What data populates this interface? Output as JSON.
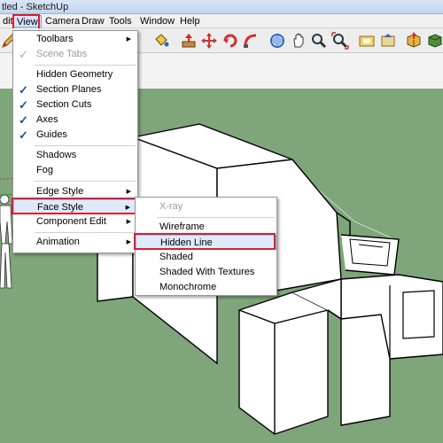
{
  "window": {
    "title": "tled - SketchUp"
  },
  "menubar": {
    "items": [
      {
        "label": "dit"
      },
      {
        "label": "View"
      },
      {
        "label": "Camera"
      },
      {
        "label": "Draw"
      },
      {
        "label": "Tools"
      },
      {
        "label": "Window"
      },
      {
        "label": "Help"
      }
    ]
  },
  "toolbar": {
    "icons": [
      "pencil-icon",
      "paint-bucket-icon",
      "push-pull-icon",
      "move-icon",
      "rotate-icon",
      "follow-me-icon",
      "orbit-icon",
      "pan-icon",
      "zoom-icon",
      "zoom-extents-icon",
      "get-models-icon",
      "share-model-icon",
      "components-icon",
      "styles-icon"
    ]
  },
  "view_menu": {
    "items": [
      {
        "label": "Toolbars",
        "submenu": true
      },
      {
        "label": "Scene Tabs",
        "checked": true,
        "disabled": true
      },
      {
        "label": "Hidden Geometry"
      },
      {
        "label": "Section Planes",
        "checked": true
      },
      {
        "label": "Section Cuts",
        "checked": true
      },
      {
        "label": "Axes",
        "checked": true
      },
      {
        "label": "Guides",
        "checked": true
      },
      {
        "label": "Shadows"
      },
      {
        "label": "Fog"
      },
      {
        "label": "Edge Style",
        "submenu": true
      },
      {
        "label": "Face Style",
        "submenu": true,
        "highlighted": true
      },
      {
        "label": "Component Edit",
        "submenu": true
      },
      {
        "label": "Animation",
        "submenu": true
      }
    ]
  },
  "face_style_menu": {
    "items": [
      {
        "label": "X-ray",
        "disabled": true
      },
      {
        "label": "Wireframe"
      },
      {
        "label": "Hidden Line",
        "highlighted": true
      },
      {
        "label": "Shaded"
      },
      {
        "label": "Shaded With Textures"
      },
      {
        "label": "Monochrome"
      }
    ]
  },
  "colors": {
    "ground": "#7fa57a",
    "sky": "#f3f3f3",
    "highlight_box": "#e01e2b",
    "axis_red": "#d32f2f",
    "axis_green": "#2e9a2e"
  }
}
